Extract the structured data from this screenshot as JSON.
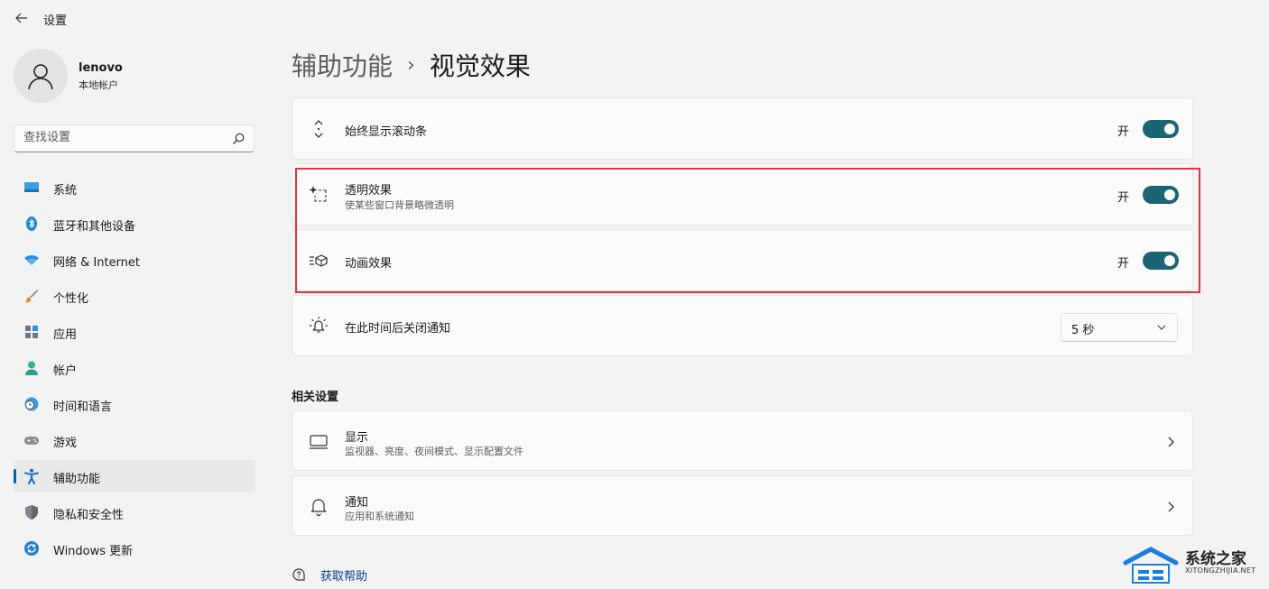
{
  "window": {
    "title": "设置",
    "back_label": "back"
  },
  "user": {
    "name": "lenovo",
    "account_type": "本地帐户"
  },
  "search": {
    "placeholder": "查找设置"
  },
  "sidebar": {
    "items": [
      {
        "label": "系统",
        "icon": "system-icon"
      },
      {
        "label": "蓝牙和其他设备",
        "icon": "bluetooth-icon"
      },
      {
        "label": "网络 & Internet",
        "icon": "wifi-icon"
      },
      {
        "label": "个性化",
        "icon": "brush-icon"
      },
      {
        "label": "应用",
        "icon": "apps-icon"
      },
      {
        "label": "帐户",
        "icon": "account-icon"
      },
      {
        "label": "时间和语言",
        "icon": "clock-globe-icon"
      },
      {
        "label": "游戏",
        "icon": "gamepad-icon"
      },
      {
        "label": "辅助功能",
        "icon": "accessibility-icon",
        "active": true
      },
      {
        "label": "隐私和安全性",
        "icon": "shield-icon"
      },
      {
        "label": "Windows 更新",
        "icon": "update-icon"
      }
    ]
  },
  "breadcrumb": {
    "parent": "辅助功能",
    "separator": "›",
    "current": "视觉效果"
  },
  "settings": {
    "scrollbars": {
      "label": "始终显示滚动条",
      "state": "开",
      "on": true
    },
    "transparency": {
      "label": "透明效果",
      "description": "使某些窗口背景略微透明",
      "state": "开",
      "on": true
    },
    "animation": {
      "label": "动画效果",
      "state": "开",
      "on": true
    },
    "notification": {
      "label": "在此时间后关闭通知",
      "value": "5 秒"
    }
  },
  "related": {
    "title": "相关设置",
    "display": {
      "label": "显示",
      "description": "监视器、亮度、夜间模式、显示配置文件"
    },
    "notifications": {
      "label": "通知",
      "description": "应用和系统通知"
    }
  },
  "help": {
    "label": "获取帮助"
  },
  "watermark": {
    "title": "系统之家",
    "url": "XITONGZHIJIA.NET"
  },
  "colors": {
    "accent": "#1a6474",
    "highlight_border": "#e0333a",
    "link": "#003e92",
    "active_indicator": "#005fb8"
  }
}
